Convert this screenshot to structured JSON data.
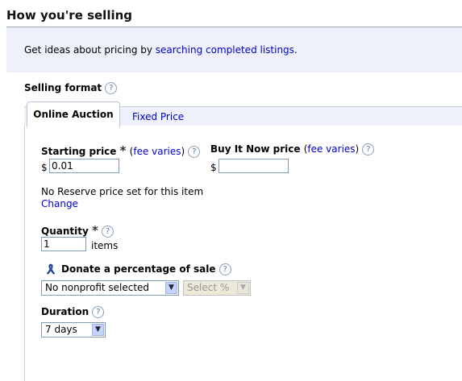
{
  "header": {
    "title": "How you're selling"
  },
  "tip": {
    "prefix": "Get ideas about pricing by ",
    "link": "searching completed listings",
    "suffix": "."
  },
  "selling_format": {
    "label": "Selling format"
  },
  "tabs": [
    {
      "label": "Online Auction",
      "active": true
    },
    {
      "label": "Fixed Price",
      "active": false
    }
  ],
  "starting_price": {
    "label": "Starting price",
    "required": "*",
    "fee_open": "(",
    "fee_link": "fee varies",
    "fee_close": ")",
    "currency": "$",
    "value": "0.01"
  },
  "buy_it_now": {
    "label": "Buy It Now price",
    "fee_open": "(",
    "fee_link": "fee varies",
    "fee_close": ")",
    "currency": "$",
    "value": ""
  },
  "reserve": {
    "text": "No Reserve price set for this item",
    "change_link": "Change"
  },
  "quantity": {
    "label": "Quantity",
    "required": "*",
    "value": "1",
    "unit": "items"
  },
  "donate": {
    "label": "Donate a percentage of sale",
    "nonprofit_selected": "No nonprofit selected",
    "percent_selected": "Select %"
  },
  "duration": {
    "label": "Duration",
    "selected": "7 days"
  },
  "icons": {
    "help": "?",
    "dropdown_arrow": "▼"
  },
  "colors": {
    "link": "#0000cc",
    "tip_bg": "#eef0fb",
    "border": "#7f9db9"
  }
}
